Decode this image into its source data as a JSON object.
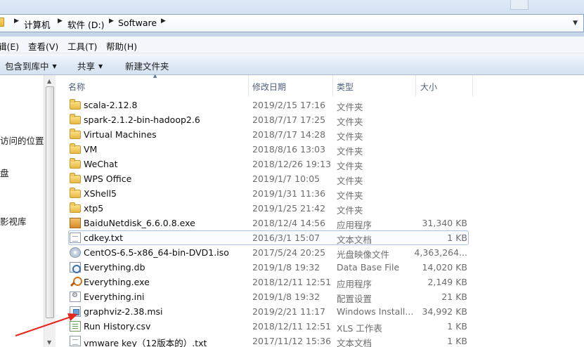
{
  "address_bar": {
    "crumbs": [
      "计算机",
      "软件 (D:)",
      "Software"
    ]
  },
  "menu": {
    "items": [
      "编辑(E)",
      "查看(V)",
      "工具(T)",
      "帮助(H)"
    ],
    "visible_texts": [
      "辑(E)",
      "查看(V)",
      "工具(T)",
      "帮助(H)"
    ]
  },
  "toolbar": {
    "include_library": "包含到库中",
    "share": "共享",
    "new_folder": "新建文件夹"
  },
  "nav_pane": {
    "items": [
      "访问的位置",
      "盘",
      "影视库"
    ]
  },
  "columns": {
    "name": "名称",
    "date": "修改日期",
    "type": "类型",
    "size": "大小"
  },
  "files": [
    {
      "name": "scala-2.12.8",
      "date": "2019/2/15 17:16",
      "type": "文件夹",
      "size": "",
      "icon": "folder-icon"
    },
    {
      "name": "spark-2.1.2-bin-hadoop2.6",
      "date": "2018/7/17 17:25",
      "type": "文件夹",
      "size": "",
      "icon": "folder-icon"
    },
    {
      "name": "Virtual Machines",
      "date": "2018/7/17 14:28",
      "type": "文件夹",
      "size": "",
      "icon": "folder-icon"
    },
    {
      "name": "VM",
      "date": "2018/8/16 13:03",
      "type": "文件夹",
      "size": "",
      "icon": "folder-icon"
    },
    {
      "name": "WeChat",
      "date": "2018/12/26 19:13",
      "type": "文件夹",
      "size": "",
      "icon": "folder-icon"
    },
    {
      "name": "WPS Office",
      "date": "2019/1/7 10:05",
      "type": "文件夹",
      "size": "",
      "icon": "folder-icon"
    },
    {
      "name": "XShell5",
      "date": "2019/1/31 11:36",
      "type": "文件夹",
      "size": "",
      "icon": "folder-icon"
    },
    {
      "name": "xtp5",
      "date": "2019/1/25 21:42",
      "type": "文件夹",
      "size": "",
      "icon": "folder-icon"
    },
    {
      "name": "BaiduNetdisk_6.6.0.8.exe",
      "date": "2018/12/4 14:56",
      "type": "应用程序",
      "size": "31,340 KB",
      "icon": "exe-icon"
    },
    {
      "name": "cdkey.txt",
      "date": "2016/3/1 15:07",
      "type": "文本文档",
      "size": "1 KB",
      "icon": "text-file-icon"
    },
    {
      "name": "CentOS-6.5-x86_64-bin-DVD1.iso",
      "date": "2017/5/24 20:25",
      "type": "光盘映像文件",
      "size": "4,363,264...",
      "icon": "disc-image-icon"
    },
    {
      "name": "Everything.db",
      "date": "2019/1/8 19:32",
      "type": "Data Base File",
      "size": "14,020 KB",
      "icon": "database-file-icon"
    },
    {
      "name": "Everything.exe",
      "date": "2018/12/11 12:51",
      "type": "应用程序",
      "size": "2,149 KB",
      "icon": "search-app-icon"
    },
    {
      "name": "Everything.ini",
      "date": "2019/1/8 19:32",
      "type": "配置设置",
      "size": "21 KB",
      "icon": "config-file-icon"
    },
    {
      "name": "graphviz-2.38.msi",
      "date": "2019/2/21 11:17",
      "type": "Windows Install...",
      "size": "34,992 KB",
      "icon": "installer-icon"
    },
    {
      "name": "Run History.csv",
      "date": "2018/12/11 12:51",
      "type": "XLS 工作表",
      "size": "1 KB",
      "icon": "spreadsheet-icon"
    },
    {
      "name": "vmware key（12版本的）.txt",
      "date": "2017/11/12 15:36",
      "type": "文本文档",
      "size": "1 KB",
      "icon": "text-file-icon"
    }
  ],
  "colors": {
    "annotation_arrow": "#e8261c",
    "selection_border": "#a8c3e4",
    "header_text": "#4c607a"
  }
}
